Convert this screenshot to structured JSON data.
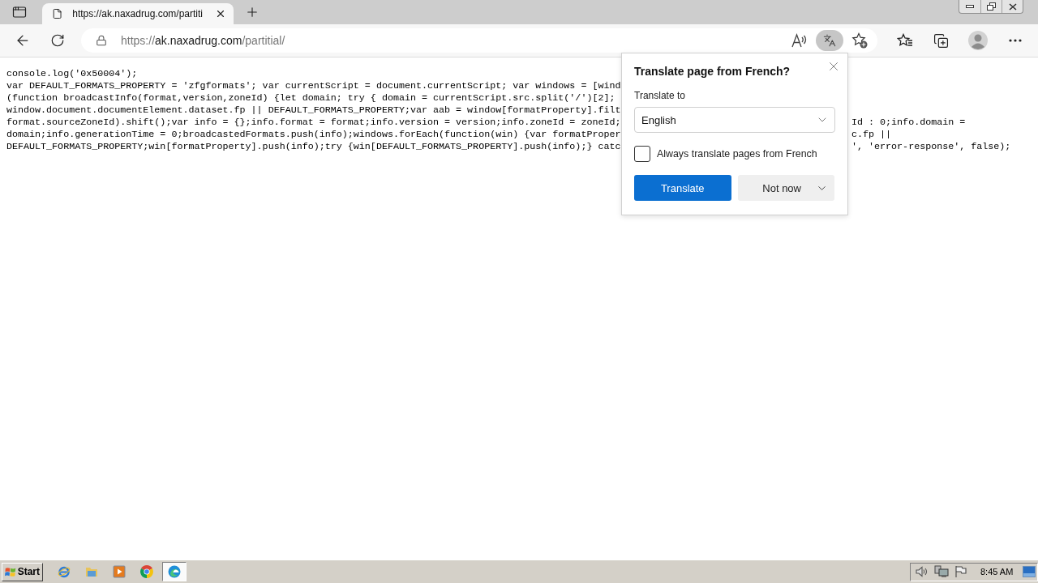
{
  "tabs": [
    {
      "title": "https://ak.naxadrug.com/partiti",
      "selected": true
    }
  ],
  "address_bar": {
    "scheme": "https://",
    "host": "ak.naxadrug.com",
    "path": "/partitial/"
  },
  "toolbar": {
    "translate_active": true
  },
  "page": {
    "code_lines": [
      {
        "text": "console.log('0x50004');"
      },
      {
        "text": "var DEFAULT_FORMATS_PROPERTY = 'zfgformats'; var currentScript = document.currentScript; var windows = [wind"
      },
      {
        "text": "(function broadcastInfo(format,version,zoneId) {let domain; try { domain = currentScript.src.split('/')[2];"
      },
      {
        "text": "window.document.documentElement.dataset.fp || DEFAULT_FORMATS_PROPERTY;var aab = window[formatProperty].filt"
      },
      {
        "text": "format.sourceZoneId).shift();var info = {};info.format = format;info.version = version;info.zoneId = zoneId;",
        "tail": "Id : 0;info.domain ="
      },
      {
        "text": "domain;info.generationTime = 0;broadcastedFormats.push(info);windows.forEach(function(win) {var formatProper",
        "tail": "c.fp ||"
      },
      {
        "text": "DEFAULT_FORMATS_PROPERTY;win[formatProperty].push(info);try {win[DEFAULT_FORMATS_PROPERTY].push(info);} catc",
        "tail": "', 'error-response', false);"
      }
    ]
  },
  "translate_popup": {
    "title": "Translate page from French?",
    "label": "Translate to",
    "language": "English",
    "always_translate": {
      "label": "Always translate pages from French",
      "checked": false
    },
    "buttons": [
      {
        "label": "Translate",
        "kind": "primary"
      },
      {
        "label": "Not now",
        "kind": "split"
      }
    ]
  },
  "taskbar": {
    "start": "Start",
    "apps": [
      {
        "kind": "orbit",
        "active": false
      },
      {
        "kind": "folder",
        "active": false
      },
      {
        "kind": "play",
        "active": false
      },
      {
        "kind": "ring",
        "active": false
      },
      {
        "kind": "wave",
        "active": true
      }
    ],
    "clock": "8:45 AM"
  }
}
